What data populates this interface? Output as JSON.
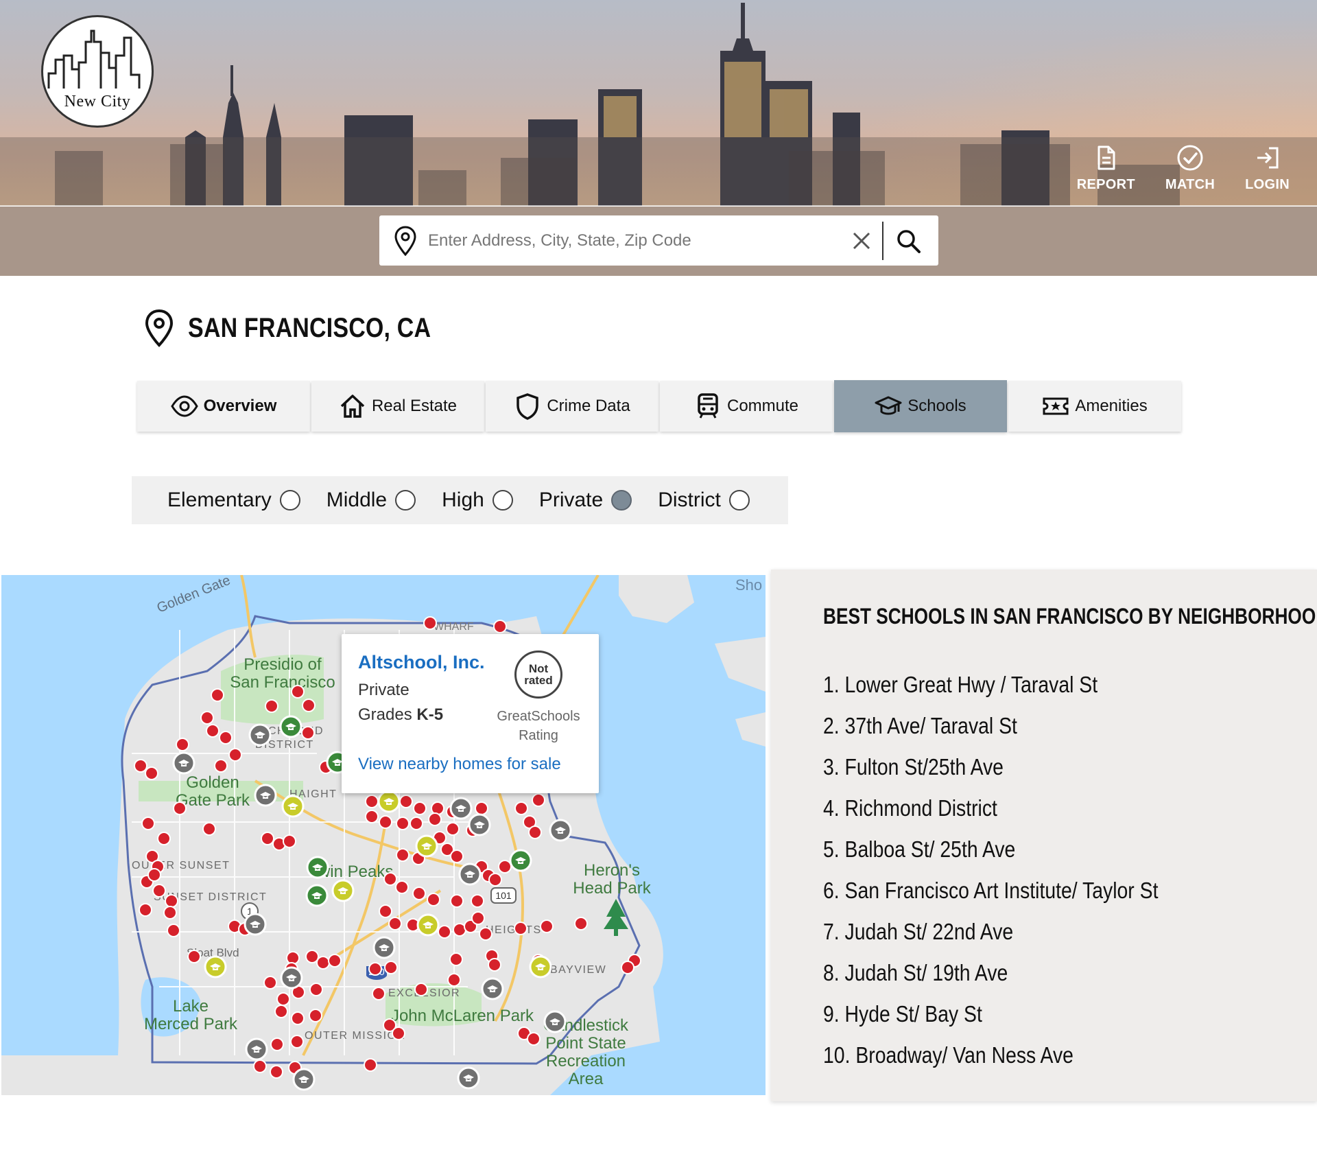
{
  "brand": {
    "logo_text": "New City"
  },
  "top_nav": [
    {
      "label": "REPORT",
      "icon": "document-icon"
    },
    {
      "label": "MATCH",
      "icon": "check-circle-icon"
    },
    {
      "label": "LOGIN",
      "icon": "login-icon"
    }
  ],
  "search": {
    "placeholder": "Enter Address, City, State, Zip Code",
    "value": ""
  },
  "location": {
    "title": "SAN FRANCISCO, CA"
  },
  "tabs": [
    {
      "label": "Overview",
      "icon": "eye-icon",
      "active": false
    },
    {
      "label": "Real Estate",
      "icon": "house-icon",
      "active": false
    },
    {
      "label": "Crime Data",
      "icon": "shield-icon",
      "active": false
    },
    {
      "label": "Commute",
      "icon": "train-icon",
      "active": false
    },
    {
      "label": "Schools",
      "icon": "graduation-cap-icon",
      "active": true
    },
    {
      "label": "Amenities",
      "icon": "ticket-icon",
      "active": false
    }
  ],
  "school_filter": [
    {
      "label": "Elementary",
      "checked": false
    },
    {
      "label": "Middle",
      "checked": false
    },
    {
      "label": "High",
      "checked": false
    },
    {
      "label": "Private",
      "checked": true
    },
    {
      "label": "District",
      "checked": false
    }
  ],
  "map": {
    "labels": {
      "golden_gate": "Golden Gate",
      "wharf": "WHARF",
      "presidio_1": "Presidio of",
      "presidio_2": "San Francisco",
      "richmond_1": "RICHMOND",
      "richmond_2": "DISTRICT",
      "golden_gate_park_1": "Golden",
      "golden_gate_park_2": "Gate Park",
      "haight": "HAIGHT",
      "outer_sunset": "OUTER SUNSET",
      "sunset_district": "SUNSET DISTRICT",
      "twin_peaks": "Twin Peaks",
      "herons_head_1": "Heron's",
      "herons_head_2": "Head Park",
      "sloat": "Sloat Blvd",
      "lake_merced_1": "Lake",
      "lake_merced_2": "Merced Park",
      "heights": "HEIGHTS",
      "bayview": "BAYVIEW",
      "excelsior": "EXCELSIOR",
      "mclaren": "John McLaren Park",
      "outer_mission": "OUTER MISSION",
      "candlestick_1": "Candlestick",
      "candlestick_2": "Point State",
      "candlestick_3": "Recreation",
      "candlestick_4": "Area",
      "shoreline": "Sho",
      "hwy_101": "101",
      "hwy_280": "280",
      "hwy_1": "1"
    },
    "colors": {
      "water": "#aadaff",
      "land": "#e8e8e8",
      "pin_red": "#d6212b",
      "pin_green": "#3a8a3a",
      "pin_yellow": "#c8cc2a",
      "pin_gray": "#707070"
    }
  },
  "popup": {
    "name": "Altschool, Inc.",
    "type": "Private",
    "grades_prefix": "Grades ",
    "grades": "K-5",
    "rating_line1": "Not",
    "rating_line2": "rated",
    "rating_label1": "GreatSchools",
    "rating_label2": "Rating",
    "link": "View nearby homes for sale"
  },
  "best_schools": {
    "title": "BEST SCHOOLS IN SAN FRANCISCO BY NEIGHBORHOOD",
    "items": [
      "1. Lower Great Hwy / Taraval St",
      "2. 37th Ave/ Taraval St",
      "3. Fulton St/25th Ave",
      "4. Richmond District",
      "5. Balboa St/ 25th Ave",
      "6. San Francisco Art Institute/ Taylor St",
      "7. Judah St/ 22nd Ave",
      "8. Judah St/ 19th Ave",
      "9. Hyde St/ Bay St",
      "10. Broadway/ Van Ness Ave"
    ]
  }
}
